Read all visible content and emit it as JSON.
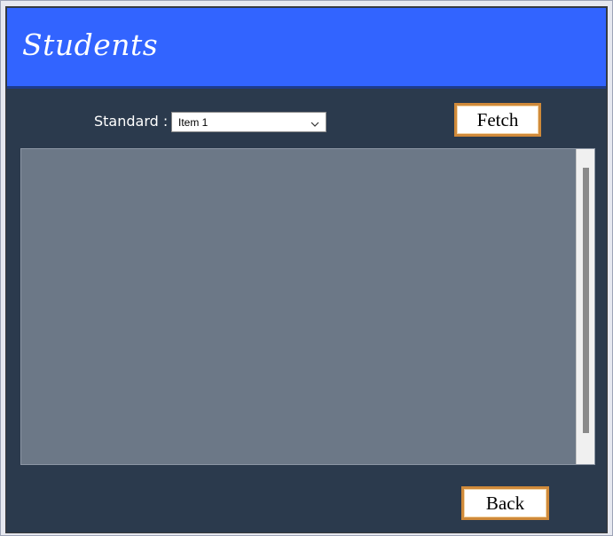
{
  "header": {
    "title": "Students"
  },
  "filter": {
    "label": "Standard :",
    "selected_value": "Item 1"
  },
  "buttons": {
    "fetch_label": "Fetch",
    "back_label": "Back"
  },
  "grid": {
    "rows": []
  },
  "colors": {
    "header_bg": "#3264ff",
    "body_bg": "#2b3a4d",
    "grid_bg": "#6c7887",
    "button_border": "#d08a3a"
  }
}
